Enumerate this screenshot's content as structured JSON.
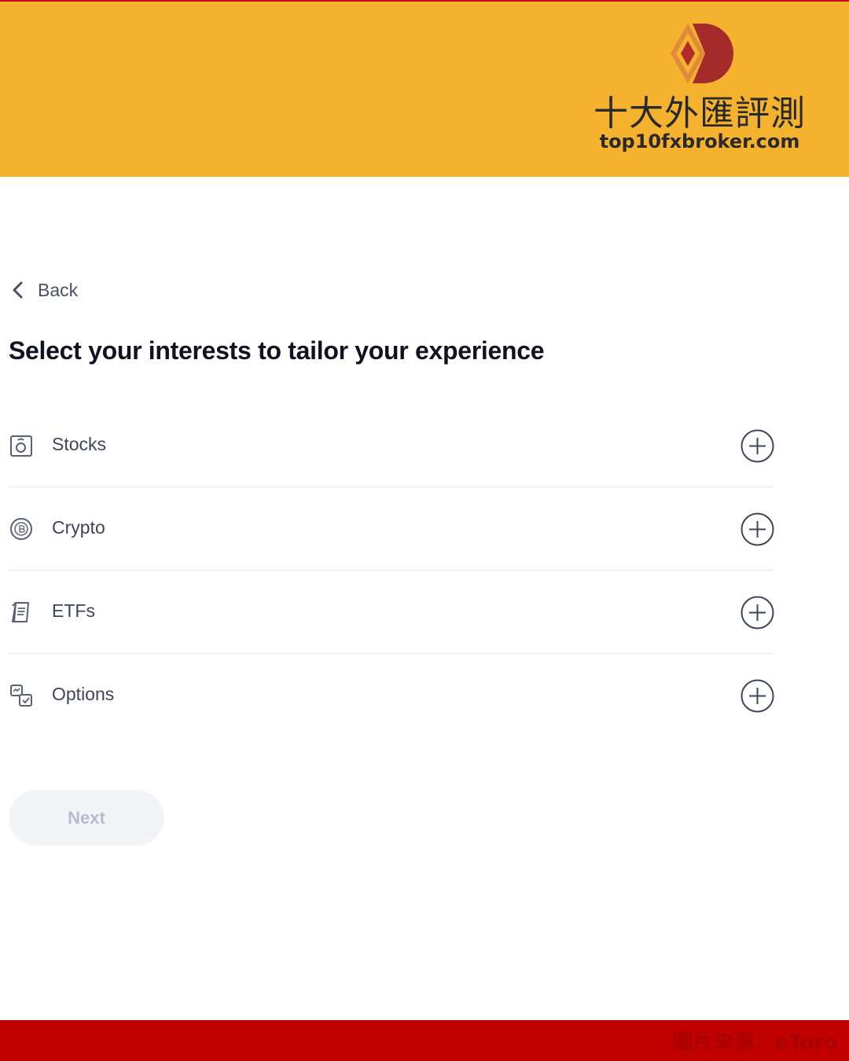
{
  "banner": {
    "brand_name": "十大外匯評測",
    "brand_url": "top10fxbroker.com",
    "logo_icon": "diamond-d-logo",
    "background_color": "#f5b22f"
  },
  "back": {
    "label": "Back",
    "icon": "chevron-left-icon"
  },
  "page_title": "Select your interests to tailor your experience",
  "interests": [
    {
      "label": "Stocks",
      "icon": "stocks-icon",
      "action_icon": "plus-circle-icon"
    },
    {
      "label": "Crypto",
      "icon": "crypto-coin-icon",
      "action_icon": "plus-circle-icon"
    },
    {
      "label": "ETFs",
      "icon": "etf-document-icon",
      "action_icon": "plus-circle-icon"
    },
    {
      "label": "Options",
      "icon": "options-icon",
      "action_icon": "plus-circle-icon"
    }
  ],
  "next_button": {
    "label": "Next",
    "state": "disabled"
  },
  "footer": {
    "caption": "圖片來源：eToro",
    "background_color": "#c10000"
  }
}
